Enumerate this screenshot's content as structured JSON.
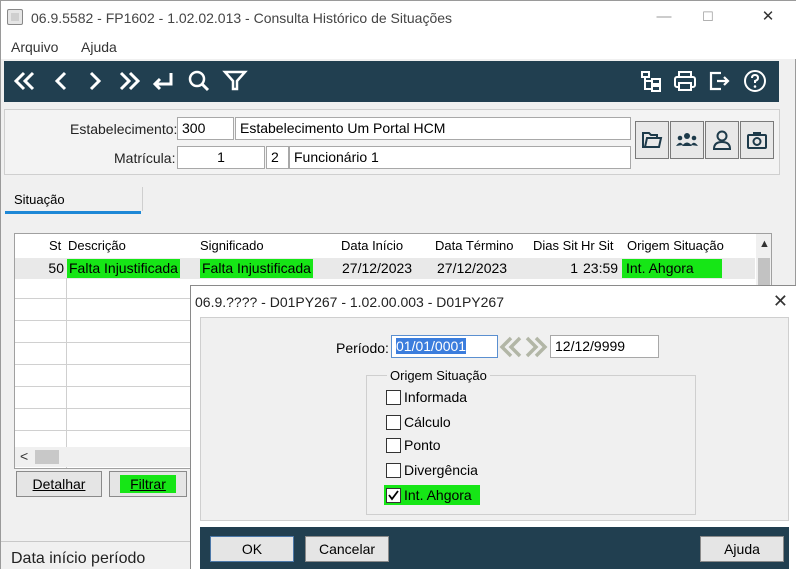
{
  "window": {
    "title": "06.9.5582 - FP1602 - 1.02.02.013 - Consulta Histórico de Situações",
    "minimize": "—",
    "maximize": "☐",
    "close": "✕"
  },
  "menu": {
    "items": [
      "Arquivo",
      "Ajuda"
    ]
  },
  "toolbar": {
    "left_icons": [
      "first-icon",
      "previous-icon",
      "next-icon",
      "last-icon",
      "return-icon",
      "search-icon",
      "filter-icon"
    ],
    "right_icons": [
      "tree-icon",
      "print-icon",
      "exit-icon",
      "help-icon"
    ],
    "color": "#213f50"
  },
  "header": {
    "establishment_label": "Estabelecimento:",
    "establishment_code": "300",
    "establishment_name": "Estabelecimento Um Portal HCM",
    "registration_label": "Matrícula:",
    "registration_number": "1",
    "registration_digit": "2",
    "employee_name": "Funcionário 1",
    "side_buttons": [
      "folder-icon",
      "group-icon",
      "person-icon",
      "camera-icon"
    ]
  },
  "tab": {
    "label": "Situação"
  },
  "grid": {
    "columns": [
      "St",
      "Descrição",
      "Significado",
      "Data Início",
      "Data Término",
      "Dias Sit",
      "Hr Sit",
      "Origem Situação"
    ],
    "rows": [
      {
        "st": "50",
        "descricao": "Falta Injustificada",
        "significado": "Falta Injustificada",
        "data_inicio": "27/12/2023",
        "data_termino": "27/12/2023",
        "dias_sit": "1",
        "hr_sit": "23:59",
        "origem": "Int. Ahgora"
      }
    ],
    "scroll_up": "▲",
    "scroll_left": "<"
  },
  "buttons": {
    "detalhar": "Detalhar",
    "filtrar": "Filtrar"
  },
  "status": {
    "text": "Data início período"
  },
  "dialog": {
    "title": "06.9.???? - D01PY267 - 1.02.00.003 - D01PY267",
    "close": "✕",
    "period_label": "Período:",
    "period_start": "01/01/0001",
    "period_end": "12/12/9999",
    "group_title": "Origem Situação",
    "options": [
      {
        "label": "Informada",
        "checked": false
      },
      {
        "label": "Cálculo",
        "checked": false
      },
      {
        "label": "Ponto",
        "checked": false
      },
      {
        "label": "Divergência",
        "checked": false
      },
      {
        "label": "Int. Ahgora",
        "checked": true
      }
    ],
    "ok": "OK",
    "cancel": "Cancelar",
    "help": "Ajuda"
  },
  "colors": {
    "highlight": "#16e616",
    "selection": "#3b7ddd",
    "accent": "#1e88d6"
  }
}
